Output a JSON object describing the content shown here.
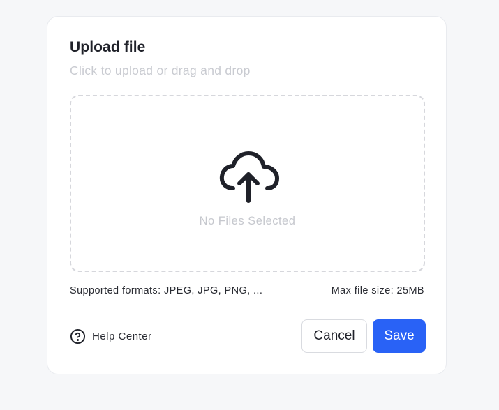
{
  "dialog": {
    "title": "Upload file",
    "subtitle": "Click to upload or drag and drop"
  },
  "dropzone": {
    "icon": "cloud-upload-icon",
    "empty_text": "No Files Selected"
  },
  "info": {
    "formats": "Supported formats: JPEG, JPG, PNG, ...",
    "max_size": "Max file size: 25MB"
  },
  "footer": {
    "help_icon": "help-circle-icon",
    "help_label": "Help Center",
    "cancel_label": "Cancel",
    "save_label": "Save"
  },
  "colors": {
    "primary": "#2962f6",
    "background": "#f6f7f9",
    "muted_text": "#c6c8ce",
    "text": "#1f2129"
  }
}
